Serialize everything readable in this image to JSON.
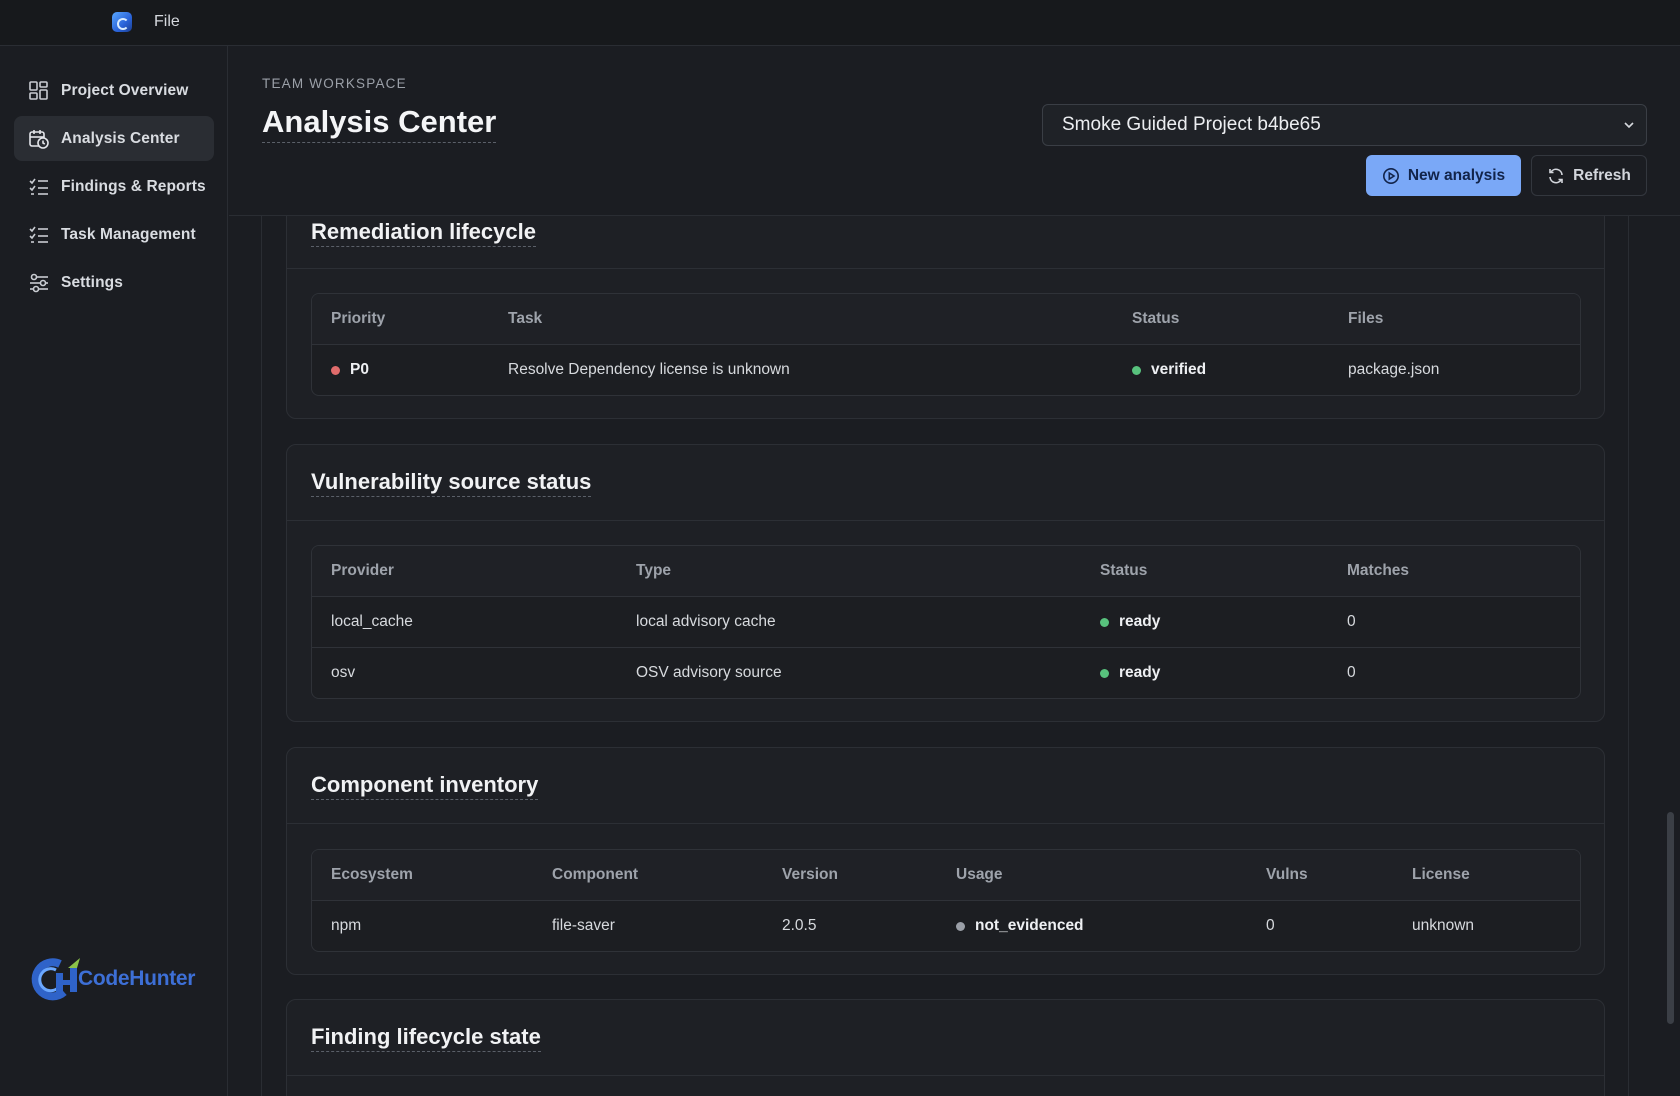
{
  "titlebar": {
    "menu_file": "File"
  },
  "sidebar": {
    "items": [
      {
        "label": "Project Overview",
        "icon": "grid-icon"
      },
      {
        "label": "Analysis Center",
        "icon": "calendar-clock-icon",
        "active": true
      },
      {
        "label": "Findings & Reports",
        "icon": "checklist-icon"
      },
      {
        "label": "Task Management",
        "icon": "checklist-icon"
      },
      {
        "label": "Settings",
        "icon": "sliders-icon"
      }
    ],
    "logo_text": "CodeHunter"
  },
  "header": {
    "eyebrow": "TEAM WORKSPACE",
    "title": "Analysis Center",
    "project_selected": "Smoke Guided Project b4be65",
    "new_analysis_label": "New analysis",
    "refresh_label": "Refresh"
  },
  "remediation": {
    "title": "Remediation lifecycle",
    "columns": [
      "Priority",
      "Task",
      "Status",
      "Files"
    ],
    "rows": [
      {
        "priority": "P0",
        "task": "Resolve Dependency license is unknown",
        "status": "verified",
        "files": "package.json"
      }
    ]
  },
  "vuln_sources": {
    "title": "Vulnerability source status",
    "columns": [
      "Provider",
      "Type",
      "Status",
      "Matches"
    ],
    "rows": [
      {
        "provider": "local_cache",
        "type": "local advisory cache",
        "status": "ready",
        "matches": "0"
      },
      {
        "provider": "osv",
        "type": "OSV advisory source",
        "status": "ready",
        "matches": "0"
      }
    ]
  },
  "components": {
    "title": "Component inventory",
    "columns": [
      "Ecosystem",
      "Component",
      "Version",
      "Usage",
      "Vulns",
      "License"
    ],
    "rows": [
      {
        "ecosystem": "npm",
        "component": "file-saver",
        "version": "2.0.5",
        "usage": "not_evidenced",
        "vulns": "0",
        "license": "unknown"
      }
    ]
  },
  "finding_lifecycle": {
    "title": "Finding lifecycle state"
  },
  "colors": {
    "accent": "#7aa8f7",
    "status_green": "#58c27d",
    "priority_red": "#e06c6c",
    "neutral_gray": "#9a9fa7"
  }
}
